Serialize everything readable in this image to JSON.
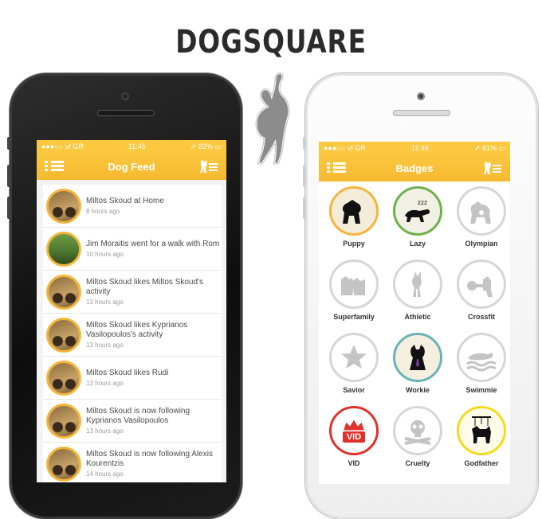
{
  "brand": {
    "name": "DOGSQUARE"
  },
  "left_phone": {
    "status": {
      "carrier": "vf GR",
      "time": "11:45",
      "battery": "82%"
    },
    "title": "Dog Feed",
    "feed": [
      {
        "text": "Miltos Skoud at Home",
        "time": "8 hours ago",
        "avatar": "bike"
      },
      {
        "text": "Jim Moraitis went for a walk with Rom",
        "time": "10 hours ago",
        "avatar": "walk"
      },
      {
        "text": "Miltos Skoud likes Miltos Skoud's activity",
        "time": "13 hours ago",
        "avatar": "bike"
      },
      {
        "text": "Miltos Skoud likes Kyprianos Vasilopoulos's activity",
        "time": "13 hours ago",
        "avatar": "bike"
      },
      {
        "text": "Miltos Skoud likes Rudi",
        "time": "13 hours ago",
        "avatar": "bike"
      },
      {
        "text": "Miltos Skoud is now following Kyprianos Vasilopoulos",
        "time": "13 hours ago",
        "avatar": "bike"
      },
      {
        "text": "Miltos Skoud is now following Alexis Kourentzis",
        "time": "14 hours ago",
        "avatar": "bike"
      }
    ]
  },
  "right_phone": {
    "status": {
      "carrier": "vf GR",
      "time": "11:46",
      "battery": "81%"
    },
    "title": "Badges",
    "badges": [
      {
        "label": "Puppy",
        "border": "#f5b43c",
        "bg": "#f3ecd8",
        "icon": "puppy-icon",
        "active": true
      },
      {
        "label": "Lazy",
        "border": "#6fb04a",
        "bg": "#f0f0e4",
        "icon": "sleeping-dog-icon",
        "active": true
      },
      {
        "label": "Olympian",
        "border": "#d6d6d6",
        "bg": "#ffffff",
        "icon": "dog-medal-icon",
        "active": false
      },
      {
        "label": "Superfamily",
        "border": "#d6d6d6",
        "bg": "#ffffff",
        "icon": "two-dogs-icon",
        "active": false
      },
      {
        "label": "Athletic",
        "border": "#d6d6d6",
        "bg": "#ffffff",
        "icon": "doberman-icon",
        "active": false
      },
      {
        "label": "Crossfit",
        "border": "#d6d6d6",
        "bg": "#ffffff",
        "icon": "dog-dumbbell-icon",
        "active": false
      },
      {
        "label": "Savior",
        "border": "#d6d6d6",
        "bg": "#ffffff",
        "icon": "star-icon",
        "active": false
      },
      {
        "label": "Workie",
        "border": "#6ab2b8",
        "bg": "#f4efdf",
        "icon": "tie-dog-icon",
        "active": true
      },
      {
        "label": "Swimmie",
        "border": "#d6d6d6",
        "bg": "#ffffff",
        "icon": "swimming-dog-icon",
        "active": false
      },
      {
        "label": "VID",
        "border": "#e0312b",
        "bg": "#ffffff",
        "icon": "crown-icon",
        "active": true,
        "text": "VID"
      },
      {
        "label": "Cruelty",
        "border": "#d6d6d6",
        "bg": "#ffffff",
        "icon": "skull-icon",
        "active": false
      },
      {
        "label": "Godfather",
        "border": "#f6d91f",
        "bg": "#fefbe9",
        "icon": "puppet-dog-icon",
        "active": true
      }
    ]
  }
}
